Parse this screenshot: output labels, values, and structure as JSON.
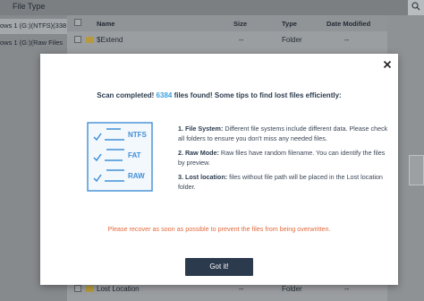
{
  "topbar": {
    "file_type_label": "File Type"
  },
  "tree": {
    "items": [
      {
        "label": "ows 1 (G:)(NTFS)(338"
      },
      {
        "label": "ows 1 (G:)(Raw Files"
      }
    ]
  },
  "table": {
    "headers": {
      "name": "Name",
      "size": "Size",
      "type": "Type",
      "date_modified": "Date Modified"
    },
    "rows": [
      {
        "name": "$Extend",
        "size": "--",
        "type": "Folder",
        "date": "--"
      },
      {
        "name": "Lost Location",
        "size": "--",
        "type": "Folder",
        "date": "--"
      }
    ]
  },
  "dialog": {
    "title_prefix": "Scan completed! ",
    "file_count": "6384",
    "title_suffix": " files found! Some tips to find lost files efficiently:",
    "illustration_labels": [
      "NTFS",
      "FAT",
      "RAW"
    ],
    "tips": [
      {
        "heading": "1. File System:",
        "text": " Different file systems include different data. Please check all folders to ensure you don't miss any needed files."
      },
      {
        "heading": "2. Raw Mode:",
        "text": " Raw files have random filename. You can identify the files by preview."
      },
      {
        "heading": "3. Lost location:",
        "text": " files without file path will be placed in the Lost location folder."
      }
    ],
    "warning": "Please recover as soon as possible to prevent the files from being overwritten.",
    "ok_label": "Got it!",
    "close_symbol": "✕"
  },
  "colors": {
    "accent_count": "#3aa0e0",
    "warning": "#e26a3c",
    "button_bg": "#2c3a4d",
    "illustration_blue": "#3f8fd6"
  },
  "icons": [
    "search-icon",
    "close-icon",
    "folder-icon",
    "checkbox-icon",
    "checkmark-icon",
    "document-icon"
  ]
}
